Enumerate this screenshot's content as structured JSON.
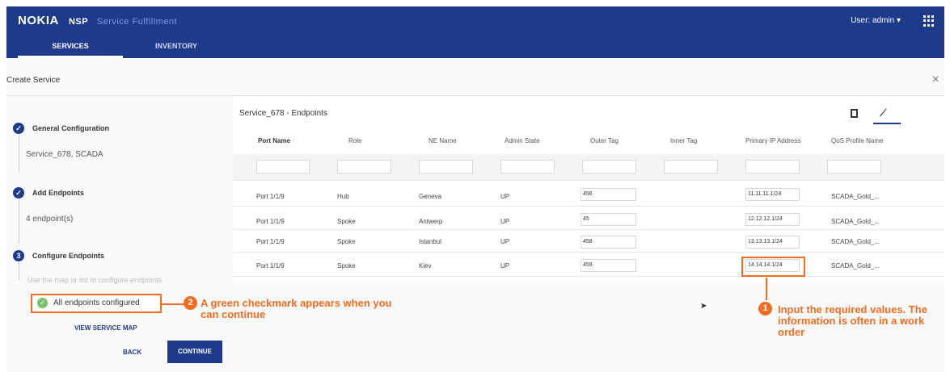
{
  "header": {
    "logo": "NOKIA",
    "product": "NSP",
    "module": "Service Fulfillment",
    "user_label": "User: admin ▾",
    "tabs": [
      "SERVICES",
      "INVENTORY"
    ]
  },
  "dialog": {
    "title": "Create Service",
    "close": "×"
  },
  "steps": [
    {
      "title": "General Configuration",
      "subtitle": "Service_678, SCADA"
    },
    {
      "title": "Add Endpoints",
      "subtitle": "4 endpoint(s)"
    },
    {
      "number": "3",
      "title": "Configure Endpoints",
      "hint": "Use the map or list to configure endpoints"
    }
  ],
  "status": {
    "all_configured": "All endpoints configured",
    "view_map": "VIEW SERVICE MAP",
    "back": "BACK",
    "continue": "CONTINUE"
  },
  "callouts": {
    "one_number": "1",
    "one_text": "Input the required values. The information is often in a work order",
    "two_number": "2",
    "two_text": "A green checkmark appears when you can continue"
  },
  "table": {
    "title": "Service_678 - Endpoints",
    "sort_indicator": "↑",
    "columns": [
      "Port Name",
      "Role",
      "NE Name",
      "Admin State",
      "Outer Tag",
      "Inner Tag",
      "Primary IP Address",
      "QoS Profile Name"
    ],
    "rows": [
      {
        "port": "Port 1/1/9",
        "role": "Hub",
        "ne": "Geneva",
        "admin": "UP",
        "outer": "456",
        "inner": "",
        "ip": "11.11.11.1/24",
        "qos": "SCADA_Gold_..."
      },
      {
        "port": "Port 1/1/9",
        "role": "Spoke",
        "ne": "Antwerp",
        "admin": "UP",
        "outer": "45",
        "inner": "",
        "ip": "12.12.12.1/24",
        "qos": "SCADA_Gold_..."
      },
      {
        "port": "Port 1/1/9",
        "role": "Spoke",
        "ne": "Istanbul",
        "admin": "UP",
        "outer": "458",
        "inner": "",
        "ip": "13.13.13.1/24",
        "qos": "SCADA_Gold_..."
      },
      {
        "port": "Port 1/1/9",
        "role": "Spoke",
        "ne": "Kiev",
        "admin": "UP",
        "outer": "459",
        "inner": "",
        "ip": "14.14.14.1/24",
        "qos": "SCADA_Gold_..."
      }
    ]
  },
  "colors": {
    "brand": "#1e3a8a",
    "accent": "#f26b21",
    "success": "#76c46b"
  }
}
